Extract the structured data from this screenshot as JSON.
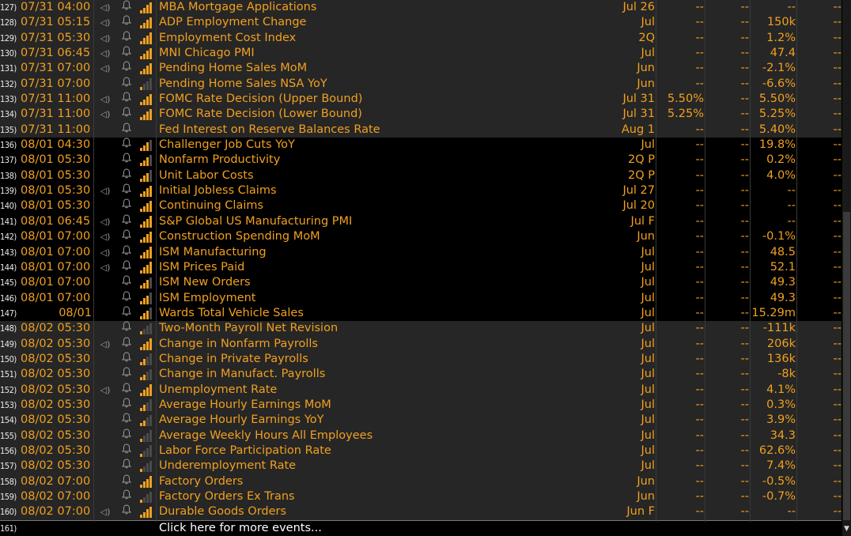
{
  "colors": {
    "accent": "#f0a020",
    "row_alt": "#262626",
    "text_white": "#ffffff"
  },
  "icons": {
    "speaker": "speaker-icon",
    "bell": "bell-icon",
    "signal": "relevance-bars-icon"
  },
  "events": [
    {
      "n": "127)",
      "dt": "07/31 04:00",
      "spk": true,
      "bars": 4,
      "name": "MBA Mortgage Applications",
      "per": "Jul 26",
      "c1": "--",
      "c2": "--",
      "c3": "--",
      "c4": "--"
    },
    {
      "n": "128)",
      "dt": "07/31 05:15",
      "spk": true,
      "bars": 4,
      "name": "ADP Employment Change",
      "per": "Jul",
      "c1": "--",
      "c2": "--",
      "c3": "150k",
      "c4": "--"
    },
    {
      "n": "129)",
      "dt": "07/31 05:30",
      "spk": true,
      "bars": 4,
      "name": "Employment Cost Index",
      "per": "2Q",
      "c1": "--",
      "c2": "--",
      "c3": "1.2%",
      "c4": "--"
    },
    {
      "n": "130)",
      "dt": "07/31 06:45",
      "spk": true,
      "bars": 4,
      "name": "MNI Chicago PMI",
      "per": "Jul",
      "c1": "--",
      "c2": "--",
      "c3": "47.4",
      "c4": "--"
    },
    {
      "n": "131)",
      "dt": "07/31 07:00",
      "spk": true,
      "bars": 4,
      "name": "Pending Home Sales MoM",
      "per": "Jun",
      "c1": "--",
      "c2": "--",
      "c3": "-2.1%",
      "c4": "--"
    },
    {
      "n": "132)",
      "dt": "07/31 07:00",
      "spk": false,
      "bars": 1,
      "name": "Pending Home Sales NSA YoY",
      "per": "Jun",
      "c1": "--",
      "c2": "--",
      "c3": "-6.6%",
      "c4": "--"
    },
    {
      "n": "133)",
      "dt": "07/31 11:00",
      "spk": true,
      "bars": 4,
      "name": "FOMC Rate Decision (Upper Bound)",
      "per": "Jul 31",
      "c1": "5.50%",
      "c2": "--",
      "c3": "5.50%",
      "c4": "--"
    },
    {
      "n": "134)",
      "dt": "07/31 11:00",
      "spk": true,
      "bars": 4,
      "name": "FOMC Rate Decision (Lower Bound)",
      "per": "Jul 31",
      "c1": "5.25%",
      "c2": "--",
      "c3": "5.25%",
      "c4": "--"
    },
    {
      "n": "135)",
      "dt": "07/31 11:00",
      "spk": false,
      "bars": 0,
      "name": "Fed Interest on Reserve Balances Rate",
      "per": "Aug 1",
      "c1": "--",
      "c2": "--",
      "c3": "5.40%",
      "c4": "--"
    },
    {
      "n": "136)",
      "dt": "08/01 04:30",
      "spk": false,
      "bars": 3,
      "name": "Challenger Job Cuts YoY",
      "per": "Jul",
      "c1": "--",
      "c2": "--",
      "c3": "19.8%",
      "c4": "--"
    },
    {
      "n": "137)",
      "dt": "08/01 05:30",
      "spk": false,
      "bars": 3,
      "name": "Nonfarm Productivity",
      "per": "2Q P",
      "c1": "--",
      "c2": "--",
      "c3": "0.2%",
      "c4": "--"
    },
    {
      "n": "138)",
      "dt": "08/01 05:30",
      "spk": false,
      "bars": 3,
      "name": "Unit Labor Costs",
      "per": "2Q P",
      "c1": "--",
      "c2": "--",
      "c3": "4.0%",
      "c4": "--"
    },
    {
      "n": "139)",
      "dt": "08/01 05:30",
      "spk": true,
      "bars": 4,
      "name": "Initial Jobless Claims",
      "per": "Jul 27",
      "c1": "--",
      "c2": "--",
      "c3": "--",
      "c4": "--"
    },
    {
      "n": "140)",
      "dt": "08/01 05:30",
      "spk": false,
      "bars": 4,
      "name": "Continuing Claims",
      "per": "Jul 20",
      "c1": "--",
      "c2": "--",
      "c3": "--",
      "c4": "--"
    },
    {
      "n": "141)",
      "dt": "08/01 06:45",
      "spk": true,
      "bars": 4,
      "name": "S&P Global US Manufacturing PMI",
      "per": "Jul F",
      "c1": "--",
      "c2": "--",
      "c3": "--",
      "c4": "--"
    },
    {
      "n": "142)",
      "dt": "08/01 07:00",
      "spk": true,
      "bars": 4,
      "name": "Construction Spending MoM",
      "per": "Jun",
      "c1": "--",
      "c2": "--",
      "c3": "-0.1%",
      "c4": "--"
    },
    {
      "n": "143)",
      "dt": "08/01 07:00",
      "spk": true,
      "bars": 4,
      "name": "ISM Manufacturing",
      "per": "Jul",
      "c1": "--",
      "c2": "--",
      "c3": "48.5",
      "c4": "--"
    },
    {
      "n": "144)",
      "dt": "08/01 07:00",
      "spk": true,
      "bars": 4,
      "name": "ISM Prices Paid",
      "per": "Jul",
      "c1": "--",
      "c2": "--",
      "c3": "52.1",
      "c4": "--"
    },
    {
      "n": "145)",
      "dt": "08/01 07:00",
      "spk": false,
      "bars": 3,
      "name": "ISM New Orders",
      "per": "Jul",
      "c1": "--",
      "c2": "--",
      "c3": "49.3",
      "c4": "--"
    },
    {
      "n": "146)",
      "dt": "08/01 07:00",
      "spk": false,
      "bars": 3,
      "name": "ISM Employment",
      "per": "Jul",
      "c1": "--",
      "c2": "--",
      "c3": "49.3",
      "c4": "--"
    },
    {
      "n": "147)",
      "dt": "08/01",
      "spk": false,
      "bars": 3,
      "name": "Wards Total Vehicle Sales",
      "per": "Jul",
      "c1": "--",
      "c2": "--",
      "c3": "15.29m",
      "c4": "--"
    },
    {
      "n": "148)",
      "dt": "08/02 05:30",
      "spk": false,
      "bars": 1,
      "name": "Two-Month Payroll Net Revision",
      "per": "Jul",
      "c1": "--",
      "c2": "--",
      "c3": "-111k",
      "c4": "--"
    },
    {
      "n": "149)",
      "dt": "08/02 05:30",
      "spk": true,
      "bars": 4,
      "name": "Change in Nonfarm Payrolls",
      "per": "Jul",
      "c1": "--",
      "c2": "--",
      "c3": "206k",
      "c4": "--"
    },
    {
      "n": "150)",
      "dt": "08/02 05:30",
      "spk": false,
      "bars": 2,
      "name": "Change in Private Payrolls",
      "per": "Jul",
      "c1": "--",
      "c2": "--",
      "c3": "136k",
      "c4": "--"
    },
    {
      "n": "151)",
      "dt": "08/02 05:30",
      "spk": false,
      "bars": 2,
      "name": "Change in Manufact. Payrolls",
      "per": "Jul",
      "c1": "--",
      "c2": "--",
      "c3": "-8k",
      "c4": "--"
    },
    {
      "n": "152)",
      "dt": "08/02 05:30",
      "spk": true,
      "bars": 4,
      "name": "Unemployment Rate",
      "per": "Jul",
      "c1": "--",
      "c2": "--",
      "c3": "4.1%",
      "c4": "--"
    },
    {
      "n": "153)",
      "dt": "08/02 05:30",
      "spk": false,
      "bars": 2,
      "name": "Average Hourly Earnings MoM",
      "per": "Jul",
      "c1": "--",
      "c2": "--",
      "c3": "0.3%",
      "c4": "--"
    },
    {
      "n": "154)",
      "dt": "08/02 05:30",
      "spk": false,
      "bars": 2,
      "name": "Average Hourly Earnings YoY",
      "per": "Jul",
      "c1": "--",
      "c2": "--",
      "c3": "3.9%",
      "c4": "--"
    },
    {
      "n": "155)",
      "dt": "08/02 05:30",
      "spk": false,
      "bars": 1,
      "name": "Average Weekly Hours All Employees",
      "per": "Jul",
      "c1": "--",
      "c2": "--",
      "c3": "34.3",
      "c4": "--"
    },
    {
      "n": "156)",
      "dt": "08/02 05:30",
      "spk": false,
      "bars": 1,
      "name": "Labor Force Participation Rate",
      "per": "Jul",
      "c1": "--",
      "c2": "--",
      "c3": "62.6%",
      "c4": "--"
    },
    {
      "n": "157)",
      "dt": "08/02 05:30",
      "spk": false,
      "bars": 1,
      "name": "Underemployment Rate",
      "per": "Jul",
      "c1": "--",
      "c2": "--",
      "c3": "7.4%",
      "c4": "--"
    },
    {
      "n": "158)",
      "dt": "08/02 07:00",
      "spk": false,
      "bars": 4,
      "name": "Factory Orders",
      "per": "Jun",
      "c1": "--",
      "c2": "--",
      "c3": "-0.5%",
      "c4": "--"
    },
    {
      "n": "159)",
      "dt": "08/02 07:00",
      "spk": false,
      "bars": 1,
      "name": "Factory Orders Ex Trans",
      "per": "Jun",
      "c1": "--",
      "c2": "--",
      "c3": "-0.7%",
      "c4": "--"
    },
    {
      "n": "160)",
      "dt": "08/02 07:00",
      "spk": true,
      "bars": 4,
      "name": "Durable Goods Orders",
      "per": "Jun F",
      "c1": "--",
      "c2": "--",
      "c3": "--",
      "c4": "--"
    }
  ],
  "footer": {
    "n": "161)",
    "label": "Click here for more events..."
  }
}
